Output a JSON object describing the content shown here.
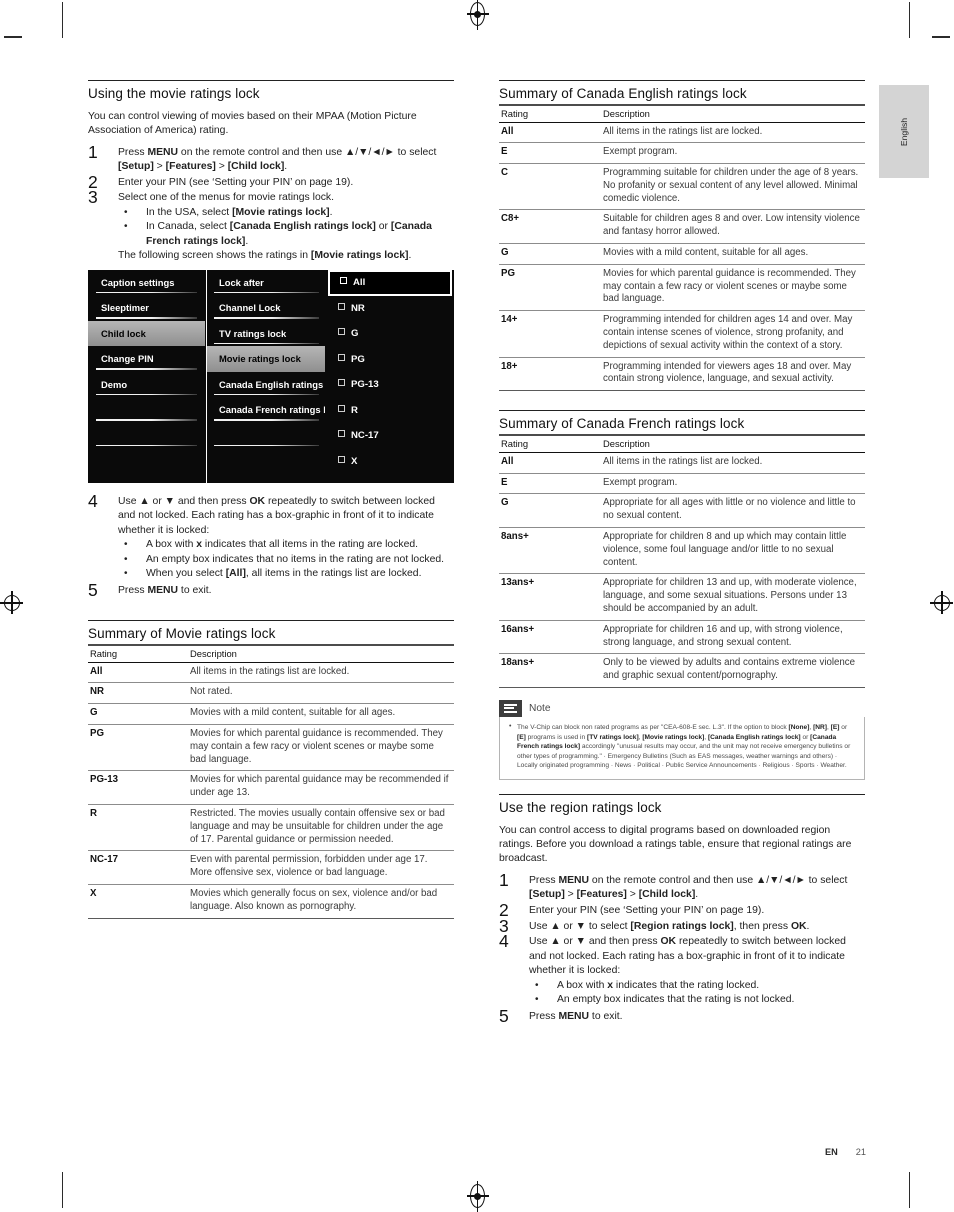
{
  "page": {
    "language_tab": "English",
    "footer_locale": "EN",
    "footer_page": "21"
  },
  "left_column": {
    "heading": "Using the movie ratings lock",
    "intro": "You can control viewing of movies based on their MPAA (Motion Picture Association of America) rating.",
    "steps": [
      {
        "num": "1",
        "text_a": "Press ",
        "bold_a": "MENU",
        "text_b": " on the remote control and then use ▲/▼/◄/► to select ",
        "bold_b": "[Setup]",
        "text_c": " > ",
        "bold_c": "[Features]",
        "text_d": " > ",
        "bold_d": "[Child lock]",
        "text_e": "."
      },
      {
        "num": "2",
        "text": "Enter your PIN (see ‘Setting your PIN’ on page 19)."
      },
      {
        "num": "3",
        "text": "Select one of the menus for movie ratings lock.",
        "bullets": [
          {
            "pre": "In the USA, select ",
            "bold": "[Movie ratings lock]",
            "post": "."
          },
          {
            "pre": "In Canada, select ",
            "bold": "[Canada English ratings lock]",
            "post": " or ",
            "bold2": "[Canada French ratings lock]",
            "post2": "."
          }
        ],
        "trailer_pre": "The following screen shows the ratings in ",
        "trailer_bold": "[Movie ratings lock]",
        "trailer_post": "."
      },
      {
        "num": "4",
        "text_a": "Use ▲ or ▼ and then press ",
        "bold_a": "OK",
        "text_b": " repeatedly to switch between locked and not locked. Each rating has a box-graphic in front of it to indicate whether it is locked:",
        "bullets": [
          {
            "pre": "A box with ",
            "bold": "x",
            "post": " indicates that all items in the rating are locked."
          },
          {
            "pre": "An empty box indicates that no items in the rating are not locked.",
            "bold": "",
            "post": ""
          },
          {
            "pre": "When you select ",
            "bold": "[All]",
            "post": ", all items in the ratings list are locked."
          }
        ]
      },
      {
        "num": "5",
        "text_a": "Press ",
        "bold_a": "MENU",
        "text_b": " to exit."
      }
    ],
    "tv_menu": {
      "column1": [
        {
          "label": "Caption settings",
          "selected": false
        },
        {
          "label": "Sleeptimer",
          "selected": false
        },
        {
          "label": "Child lock",
          "selected": true
        },
        {
          "label": "Change PIN",
          "selected": false
        },
        {
          "label": "Demo",
          "selected": false
        },
        {
          "label": "",
          "selected": false
        },
        {
          "label": "",
          "selected": false
        },
        {
          "label": "",
          "selected": false
        }
      ],
      "column2": [
        {
          "label": "Lock after",
          "selected": false
        },
        {
          "label": "Channel Lock",
          "selected": false
        },
        {
          "label": "TV ratings lock",
          "selected": false
        },
        {
          "label": "Movie ratings lock",
          "selected": true
        },
        {
          "label": "Canada English ratings l...",
          "selected": false
        },
        {
          "label": "Canada French ratings l...",
          "selected": false
        },
        {
          "label": "",
          "selected": false
        },
        {
          "label": "",
          "selected": false
        }
      ],
      "ratings": [
        {
          "label": "All",
          "highlighted": true
        },
        {
          "label": "NR",
          "highlighted": false
        },
        {
          "label": "G",
          "highlighted": false
        },
        {
          "label": "PG",
          "highlighted": false
        },
        {
          "label": "PG-13",
          "highlighted": false
        },
        {
          "label": "R",
          "highlighted": false
        },
        {
          "label": "NC-17",
          "highlighted": false
        },
        {
          "label": "X",
          "highlighted": false
        }
      ]
    },
    "movie_table": {
      "heading": "Summary of Movie ratings lock",
      "columns": [
        "Rating",
        "Description"
      ],
      "rows": [
        {
          "rating": "All",
          "description": "All items in the ratings list are locked."
        },
        {
          "rating": "NR",
          "description": "Not rated."
        },
        {
          "rating": "G",
          "description": "Movies with a mild content, suitable for all ages."
        },
        {
          "rating": "PG",
          "description": "Movies for which parental guidance is recommended. They may contain a few racy or violent scenes or maybe some bad language."
        },
        {
          "rating": "PG-13",
          "description": "Movies for which parental guidance may be recommended if under age 13."
        },
        {
          "rating": "R",
          "description": "Restricted. The movies usually contain offensive sex or bad language and may be unsuitable for children under the age of 17. Parental guidance or permission needed."
        },
        {
          "rating": "NC-17",
          "description": "Even with parental permission, forbidden under age 17. More offensive sex, violence or bad language."
        },
        {
          "rating": "X",
          "description": "Movies which generally focus on sex, violence and/or bad language. Also known as pornography."
        }
      ]
    }
  },
  "right_column": {
    "canada_english_table": {
      "heading": "Summary of Canada English ratings lock",
      "columns": [
        "Rating",
        "Description"
      ],
      "rows": [
        {
          "rating": "All",
          "description": "All items in the ratings list are locked."
        },
        {
          "rating": "E",
          "description": "Exempt program."
        },
        {
          "rating": "C",
          "description": "Programming suitable for children under the age of 8 years. No profanity or sexual content of any level allowed. Minimal comedic violence."
        },
        {
          "rating": "C8+",
          "description": "Suitable for children ages 8 and over. Low intensity violence and fantasy horror allowed."
        },
        {
          "rating": "G",
          "description": "Movies with a mild content, suitable for all ages."
        },
        {
          "rating": "PG",
          "description": "Movies for which parental guidance is recommended. They may contain a few racy or violent scenes or maybe some bad language."
        },
        {
          "rating": "14+",
          "description": "Programming intended for children ages 14 and over. May contain intense scenes of violence, strong profanity, and depictions of sexual activity within the context of a story."
        },
        {
          "rating": "18+",
          "description": "Programming intended for viewers ages 18 and over. May contain strong violence, language, and sexual activity."
        }
      ]
    },
    "canada_french_table": {
      "heading": "Summary of Canada French ratings lock",
      "columns": [
        "Rating",
        "Description"
      ],
      "rows": [
        {
          "rating": "All",
          "description": "All items in the ratings list are locked."
        },
        {
          "rating": "E",
          "description": "Exempt program."
        },
        {
          "rating": "G",
          "description": "Appropriate for all ages with little or no violence and little to no sexual content."
        },
        {
          "rating": "8ans+",
          "description": "Appropriate for children 8 and up which may contain little violence, some foul language and/or little to no sexual content."
        },
        {
          "rating": "13ans+",
          "description": "Appropriate for children 13 and up, with moderate violence, language, and some sexual situations. Persons under 13 should be accompanied by an adult."
        },
        {
          "rating": "16ans+",
          "description": "Appropriate for children 16 and up, with strong violence, strong language, and strong sexual content."
        },
        {
          "rating": "18ans+",
          "description": "Only to be viewed by adults and contains extreme violence and graphic sexual content/pornography."
        }
      ]
    },
    "note": {
      "label": "Note",
      "seg1": "The V-Chip can block non rated programs as per \"CEA-608-E sec. L.3\". If the option to block ",
      "b1": "[None]",
      "seg2": ", ",
      "b2": "[NR]",
      "seg3": ", ",
      "b3": "[E]",
      "seg4": " or ",
      "b4": "[E]",
      "seg5": " programs is used in ",
      "b5": "[TV ratings lock]",
      "seg6": ", ",
      "b6": "[Movie ratings lock]",
      "seg7": ", ",
      "b7": "[Canada English ratings lock]",
      "seg8": " or ",
      "b8": "[Canada French ratings lock]",
      "seg9": " accordingly \"unusual results may occur, and the unit may not receive emergency bulletins or other types of programming.\" · Emergency Bulletins (Such as EAS messages, weather warnings and others) · Locally originated programming · News · Political · Public Service Announcements · Religious · Sports · Weather."
    },
    "region_section": {
      "heading": "Use the region ratings lock",
      "intro": "You can control access to digital programs based on downloaded region ratings. Before you download a ratings table, ensure that regional ratings are broadcast.",
      "steps": [
        {
          "num": "1",
          "text_a": "Press ",
          "bold_a": "MENU",
          "text_b": " on the remote control and then use ▲/▼/◄/► to select ",
          "bold_b": "[Setup]",
          "text_c": " > ",
          "bold_c": "[Features]",
          "text_d": " > ",
          "bold_d": "[Child lock]",
          "text_e": "."
        },
        {
          "num": "2",
          "text": "Enter your PIN (see ‘Setting your PIN’ on page 19)."
        },
        {
          "num": "3",
          "text_a": "Use ▲ or ▼ to select ",
          "bold_a": "[Region ratings lock]",
          "text_b": ", then press ",
          "bold_b": "OK",
          "text_c": "."
        },
        {
          "num": "4",
          "text_a": "Use ▲ or ▼ and then press ",
          "bold_a": "OK",
          "text_b": " repeatedly to switch between locked and not locked. Each rating has a box-graphic in front of it to indicate whether it is locked:",
          "bullets": [
            {
              "pre": "A box with ",
              "bold": "x",
              "post": " indicates that the rating locked."
            },
            {
              "pre": "An empty box indicates that the rating is not locked.",
              "bold": "",
              "post": ""
            }
          ]
        },
        {
          "num": "5",
          "text_a": "Press ",
          "bold_a": "MENU",
          "text_b": " to exit."
        }
      ]
    }
  }
}
